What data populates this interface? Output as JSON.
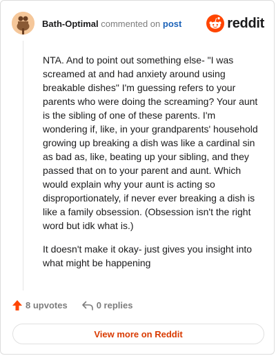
{
  "header": {
    "username": "Bath-Optimal",
    "action_text": "commented on",
    "post_link": "post",
    "brand_name": "reddit"
  },
  "comment": {
    "paragraphs": [
      "NTA. And to point out something else- \"I was screamed at and had anxiety around using breakable dishes\" I'm guessing refers to your parents who were doing the screaming? Your aunt is the sibling of one of these parents. I'm wondering if, like, in your grandparents' household growing up breaking a dish was like a cardinal sin as bad as, like, beating up your sibling, and they passed that on to your parent and aunt. Which would explain why your aunt is acting so disproportionately, if never ever breaking a dish is like a family obsession. (Obsession isn't the right word but idk what is.)",
      "It doesn't make it okay- just gives you insight into what might be happening"
    ]
  },
  "actions": {
    "upvotes_label": "8 upvotes",
    "replies_label": "0 replies"
  },
  "footer": {
    "view_more_label": "View more on Reddit"
  },
  "colors": {
    "brand_orange": "#ff4500",
    "link_blue": "#1b62b8",
    "view_more_orange": "#d93a00"
  },
  "icons": [
    "avatar-icon",
    "reddit-logo-icon",
    "upvote-arrow-icon",
    "reply-icon"
  ]
}
